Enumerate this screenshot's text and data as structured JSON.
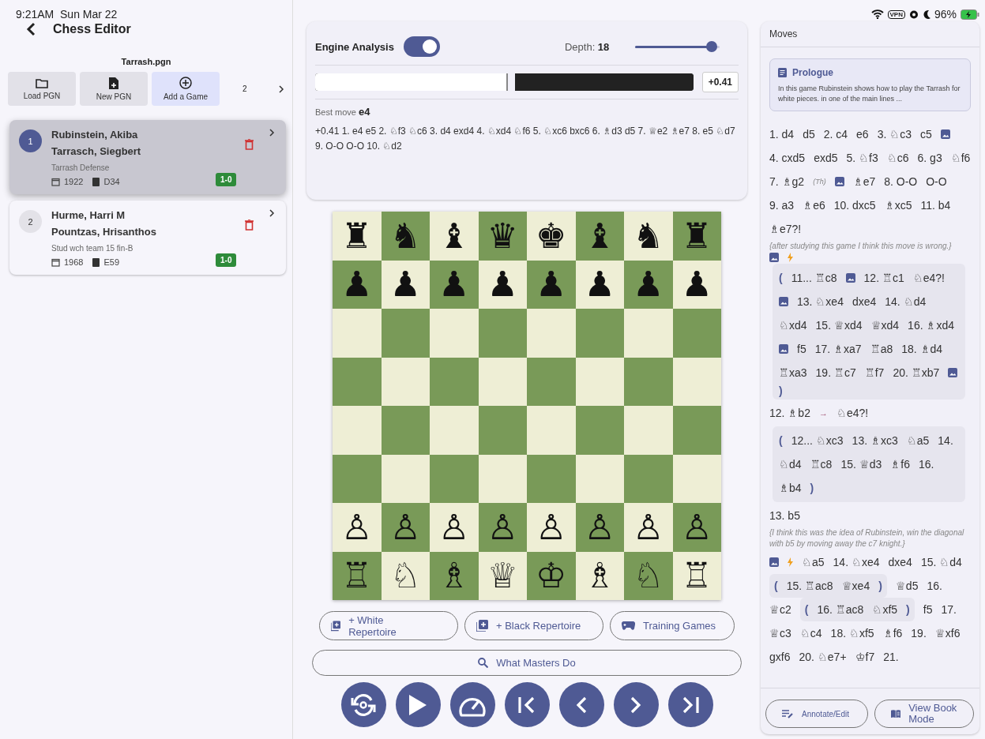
{
  "status_bar": {
    "time": "9:21AM",
    "date": "Sun Mar 22",
    "vpn": "VPN",
    "battery": "96%"
  },
  "header": {
    "title": "Chess Editor"
  },
  "file": {
    "name": "Tarrash.pgn"
  },
  "toolbar": [
    {
      "kind": "folder",
      "label": "Load PGN",
      "selected": false
    },
    {
      "kind": "newfile",
      "label": "New PGN",
      "selected": false
    },
    {
      "kind": "add",
      "label": "Add a Game",
      "selected": true
    }
  ],
  "game_count": "2",
  "games": [
    {
      "number": "1",
      "white": "Rubinstein, Akiba",
      "black": "Tarrasch, Siegbert",
      "event": "Tarrash Defense",
      "year": "1922",
      "eco": "D34",
      "result": "1-0",
      "selected": true
    },
    {
      "number": "2",
      "white": "Hurme, Harri M",
      "black": "Pountzas, Hrisanthos",
      "event": "Stud wch team 15 fin-B",
      "year": "1968",
      "eco": "E59",
      "result": "1-0",
      "selected": false
    }
  ],
  "engine": {
    "title": "Engine Analysis",
    "on": true,
    "depth_label": "Depth:",
    "depth": "18",
    "depth_slider": {
      "level": 0.9
    },
    "eval_bar": {
      "level": 0.51
    },
    "eval": "+0.41",
    "best_label": "Best move",
    "best_move": "e4",
    "line": "+0.41  1. e4 e5 2. ♘f3 ♘c6 3. d4 exd4 4. ♘xd4 ♘f6 5. ♘xc6 bxc6 6. ♗d3 d5 7. ♕e2 ♗e7 8. e5 ♘d7 9. O-O O-O 10. ♘d2"
  },
  "board": {
    "ranks": [
      [
        {
          "kind": "piece",
          "piece": "♜"
        },
        {
          "kind": "piece",
          "piece": "♞"
        },
        {
          "kind": "piece",
          "piece": "♝"
        },
        {
          "kind": "piece",
          "piece": "♛"
        },
        {
          "kind": "piece",
          "piece": "♚"
        },
        {
          "kind": "piece",
          "piece": "♝"
        },
        {
          "kind": "piece",
          "piece": "♞"
        },
        {
          "kind": "piece",
          "piece": "♜"
        }
      ],
      [
        {
          "kind": "piece",
          "piece": "♟"
        },
        {
          "kind": "piece",
          "piece": "♟"
        },
        {
          "kind": "piece",
          "piece": "♟"
        },
        {
          "kind": "piece",
          "piece": "♟"
        },
        {
          "kind": "piece",
          "piece": "♟"
        },
        {
          "kind": "piece",
          "piece": "♟"
        },
        {
          "kind": "piece",
          "piece": "♟"
        },
        {
          "kind": "piece",
          "piece": "♟"
        }
      ],
      [
        {
          "kind": "empty"
        },
        {
          "kind": "empty"
        },
        {
          "kind": "empty"
        },
        {
          "kind": "empty"
        },
        {
          "kind": "empty"
        },
        {
          "kind": "empty"
        },
        {
          "kind": "empty"
        },
        {
          "kind": "empty"
        }
      ],
      [
        {
          "kind": "empty"
        },
        {
          "kind": "empty"
        },
        {
          "kind": "empty"
        },
        {
          "kind": "empty"
        },
        {
          "kind": "empty"
        },
        {
          "kind": "empty"
        },
        {
          "kind": "empty"
        },
        {
          "kind": "empty"
        }
      ],
      [
        {
          "kind": "empty"
        },
        {
          "kind": "empty"
        },
        {
          "kind": "empty"
        },
        {
          "kind": "empty"
        },
        {
          "kind": "empty"
        },
        {
          "kind": "empty"
        },
        {
          "kind": "empty"
        },
        {
          "kind": "empty"
        }
      ],
      [
        {
          "kind": "empty"
        },
        {
          "kind": "empty"
        },
        {
          "kind": "empty"
        },
        {
          "kind": "empty"
        },
        {
          "kind": "empty"
        },
        {
          "kind": "empty"
        },
        {
          "kind": "empty"
        },
        {
          "kind": "empty"
        }
      ],
      [
        {
          "kind": "piece",
          "piece": "♙"
        },
        {
          "kind": "piece",
          "piece": "♙"
        },
        {
          "kind": "piece",
          "piece": "♙"
        },
        {
          "kind": "piece",
          "piece": "♙"
        },
        {
          "kind": "piece",
          "piece": "♙"
        },
        {
          "kind": "piece",
          "piece": "♙"
        },
        {
          "kind": "piece",
          "piece": "♙"
        },
        {
          "kind": "piece",
          "piece": "♙"
        }
      ],
      [
        {
          "kind": "piece",
          "piece": "♖"
        },
        {
          "kind": "piece",
          "piece": "♘"
        },
        {
          "kind": "piece",
          "piece": "♗"
        },
        {
          "kind": "piece",
          "piece": "♕"
        },
        {
          "kind": "piece",
          "piece": "♔"
        },
        {
          "kind": "piece",
          "piece": "♗"
        },
        {
          "kind": "piece",
          "piece": "♘"
        },
        {
          "kind": "piece",
          "piece": "♖"
        }
      ]
    ]
  },
  "actions": [
    {
      "kind": "library",
      "label": "+ White Repertoire"
    },
    {
      "kind": "library",
      "label": "+ Black Repertoire"
    },
    {
      "kind": "gamepad",
      "label": "Training Games"
    }
  ],
  "search_button": {
    "label": "What Masters Do"
  },
  "nav_buttons": [
    {
      "kind": "flip"
    },
    {
      "kind": "play"
    },
    {
      "kind": "gauge"
    },
    {
      "kind": "first"
    },
    {
      "kind": "prev"
    },
    {
      "kind": "next"
    },
    {
      "kind": "last"
    }
  ],
  "moves_panel": {
    "title": "Moves",
    "prologue": {
      "title": "Prologue",
      "text": "In this game Rubinstein shows how to play the Tarrash for white pieces. in one of the main lines ..."
    },
    "tokens": [
      {
        "kind": "move",
        "text": "1. d4"
      },
      {
        "kind": "move",
        "text": "d5"
      },
      {
        "kind": "move",
        "text": "2. c4"
      },
      {
        "kind": "move",
        "text": "e6"
      },
      {
        "kind": "move",
        "text": "3. ♘c3"
      },
      {
        "kind": "move",
        "text": "c5"
      },
      {
        "kind": "image"
      },
      {
        "kind": "move",
        "text": "4. cxd5"
      },
      {
        "kind": "move",
        "text": "exd5"
      },
      {
        "kind": "move",
        "text": "5. ♘f3"
      },
      {
        "kind": "move",
        "text": "♘c6"
      },
      {
        "kind": "move",
        "text": "6. g3"
      },
      {
        "kind": "move",
        "text": "♘f6"
      },
      {
        "kind": "move",
        "text": "7. ♗g2"
      },
      {
        "kind": "note",
        "text": "(Th)"
      },
      {
        "kind": "image"
      },
      {
        "kind": "move",
        "text": "♗e7"
      },
      {
        "kind": "move",
        "text": "8. O-O"
      },
      {
        "kind": "move",
        "text": "O-O"
      },
      {
        "kind": "move",
        "text": "9. a3"
      },
      {
        "kind": "move",
        "text": "♗e6"
      },
      {
        "kind": "move",
        "text": "10. dxc5"
      },
      {
        "kind": "move",
        "text": "♗xc5"
      },
      {
        "kind": "move",
        "text": "11. b4"
      },
      {
        "kind": "move",
        "text": "♗e7?!"
      },
      {
        "kind": "comment",
        "text": "{after studying this game I think this move is wrong.}"
      },
      {
        "kind": "image"
      },
      {
        "kind": "bolt"
      },
      {
        "kind": "break"
      },
      {
        "kind": "variation",
        "tokens": [
          {
            "kind": "paren",
            "text": "("
          },
          {
            "kind": "move",
            "text": "11... ♖c8"
          },
          {
            "kind": "image"
          },
          {
            "kind": "move",
            "text": "12. ♖c1"
          },
          {
            "kind": "move",
            "text": "♘e4?!"
          },
          {
            "kind": "image"
          },
          {
            "kind": "move",
            "text": "13. ♘xe4"
          },
          {
            "kind": "move",
            "text": "dxe4"
          },
          {
            "kind": "move",
            "text": "14. ♘d4"
          },
          {
            "kind": "move",
            "text": "♘xd4"
          },
          {
            "kind": "move",
            "text": "15. ♕xd4"
          },
          {
            "kind": "move",
            "text": "♕xd4"
          },
          {
            "kind": "move",
            "text": "16. ♗xd4"
          },
          {
            "kind": "image"
          },
          {
            "kind": "move",
            "text": "f5"
          },
          {
            "kind": "move",
            "text": "17. ♗xa7"
          },
          {
            "kind": "move",
            "text": "♖a8"
          },
          {
            "kind": "move",
            "text": "18. ♗d4"
          },
          {
            "kind": "move",
            "text": "♖xa3"
          },
          {
            "kind": "move",
            "text": "19. ♖c7"
          },
          {
            "kind": "move",
            "text": "♖f7"
          },
          {
            "kind": "move",
            "text": "20. ♖xb7"
          },
          {
            "kind": "image"
          },
          {
            "kind": "paren",
            "text": ")"
          }
        ]
      },
      {
        "kind": "move",
        "text": "12. ♗b2"
      },
      {
        "kind": "arrow",
        "text": "→"
      },
      {
        "kind": "move",
        "text": "♘e4?!"
      },
      {
        "kind": "variation",
        "tokens": [
          {
            "kind": "paren",
            "text": "("
          },
          {
            "kind": "move",
            "text": "12... ♘xc3"
          },
          {
            "kind": "move",
            "text": "13. ♗xc3"
          },
          {
            "kind": "move",
            "text": "♘a5"
          },
          {
            "kind": "move",
            "text": "14."
          },
          {
            "kind": "move",
            "text": "♘d4"
          },
          {
            "kind": "move",
            "text": "♖c8"
          },
          {
            "kind": "move",
            "text": "15. ♕d3"
          },
          {
            "kind": "move",
            "text": "♗f6"
          },
          {
            "kind": "move",
            "text": "16."
          },
          {
            "kind": "move",
            "text": "♗b4"
          },
          {
            "kind": "paren",
            "text": ")"
          }
        ]
      },
      {
        "kind": "move",
        "text": "13. b5"
      },
      {
        "kind": "comment",
        "text": "{I think this was the idea of Rubinstein, win the diagonal with b5 by moving away the c7 knight.}"
      },
      {
        "kind": "image"
      },
      {
        "kind": "bolt"
      },
      {
        "kind": "move",
        "text": "♘a5"
      },
      {
        "kind": "move",
        "text": "14. ♘xe4"
      },
      {
        "kind": "move",
        "text": "dxe4"
      },
      {
        "kind": "move",
        "text": "15. ♘d4"
      },
      {
        "kind": "subline",
        "tokens": [
          {
            "kind": "paren",
            "text": "("
          },
          {
            "kind": "move",
            "text": "15. ♖ac8"
          },
          {
            "kind": "move",
            "text": "♕xe4"
          },
          {
            "kind": "paren",
            "text": ")"
          }
        ]
      },
      {
        "kind": "move",
        "text": "♕d5"
      },
      {
        "kind": "move",
        "text": "16."
      },
      {
        "kind": "move",
        "text": "♕c2"
      },
      {
        "kind": "subline",
        "tokens": [
          {
            "kind": "paren",
            "text": "("
          },
          {
            "kind": "move",
            "text": "16. ♖ac8"
          },
          {
            "kind": "move",
            "text": "♘xf5"
          },
          {
            "kind": "paren",
            "text": ")"
          }
        ]
      },
      {
        "kind": "move",
        "text": "f5"
      },
      {
        "kind": "move",
        "text": "17."
      },
      {
        "kind": "move",
        "text": "♕c3"
      },
      {
        "kind": "move",
        "text": "♘c4"
      },
      {
        "kind": "move",
        "text": "18. ♘xf5"
      },
      {
        "kind": "move",
        "text": "♗f6"
      },
      {
        "kind": "move",
        "text": "19."
      },
      {
        "kind": "move",
        "text": "♕xf6"
      },
      {
        "kind": "move",
        "text": "gxf6"
      },
      {
        "kind": "move",
        "text": "20. ♘e7+"
      },
      {
        "kind": "move",
        "text": "♔f7"
      },
      {
        "kind": "move",
        "text": "21."
      }
    ],
    "footer": [
      {
        "kind": "edit",
        "label": "Annotate/Edit"
      },
      {
        "kind": "book",
        "label": "View Book Mode"
      }
    ]
  }
}
